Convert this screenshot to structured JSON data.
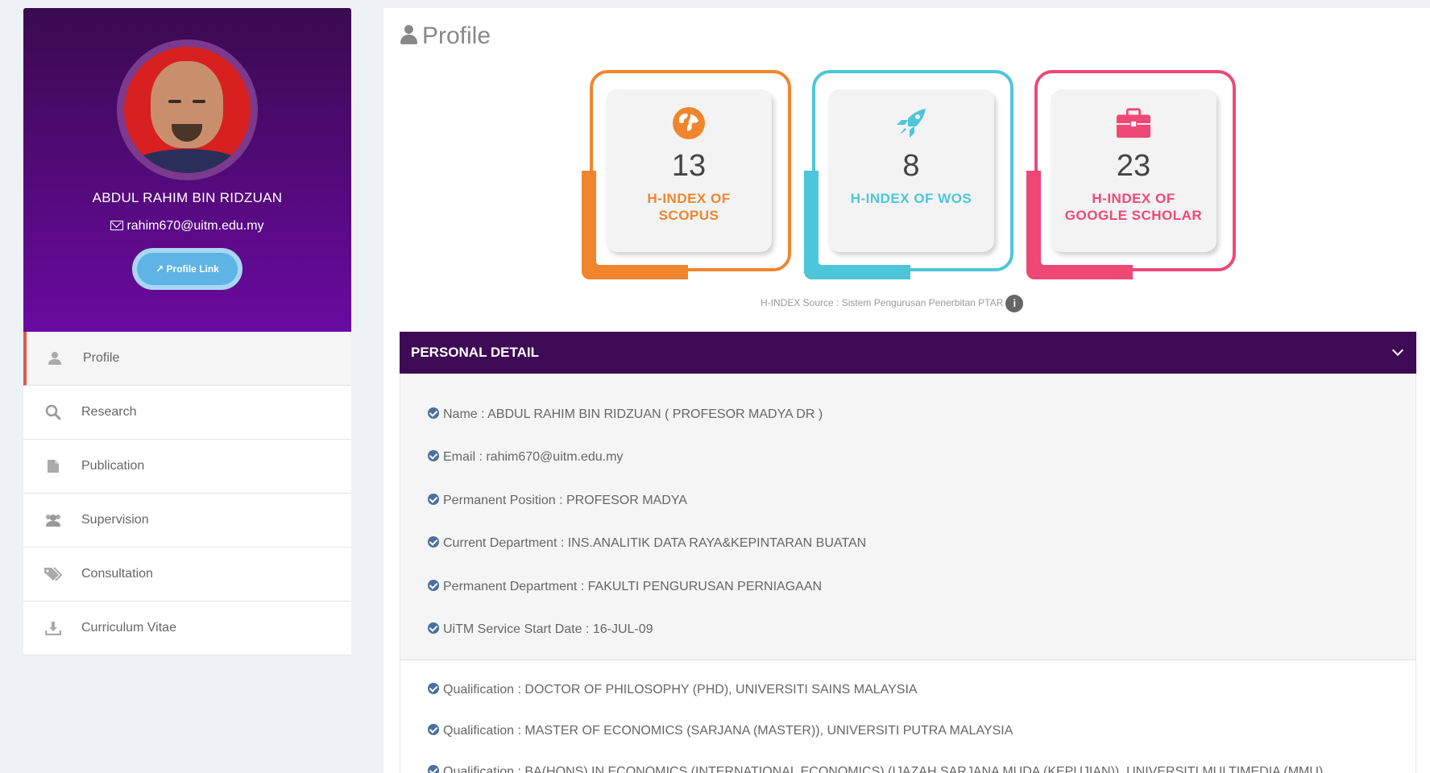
{
  "user": {
    "name": "ABDUL RAHIM BIN RIDZUAN",
    "email": "rahim670@uitm.edu.my",
    "profile_link_label": "Profile Link"
  },
  "nav": {
    "items": [
      {
        "label": "Profile",
        "icon": "user-icon",
        "active": true
      },
      {
        "label": "Research",
        "icon": "search-icon"
      },
      {
        "label": "Publication",
        "icon": "document-icon"
      },
      {
        "label": "Supervision",
        "icon": "users-icon"
      },
      {
        "label": "Consultation",
        "icon": "tags-icon"
      },
      {
        "label": "Curriculum Vitae",
        "icon": "download-icon"
      }
    ]
  },
  "page": {
    "title": "Profile"
  },
  "stats": [
    {
      "value": "13",
      "label_line1": "H-INDEX OF",
      "label_line2": "SCOPUS",
      "color": "#f0852d",
      "icon": "globe-icon"
    },
    {
      "value": "8",
      "label_line1": "H-INDEX OF WOS",
      "label_line2": "",
      "color": "#4cc6d8",
      "icon": "rocket-icon"
    },
    {
      "value": "23",
      "label_line1": "H-INDEX OF",
      "label_line2": "GOOGLE SCHOLAR",
      "color": "#ef4877",
      "icon": "briefcase-icon"
    }
  ],
  "source_note": "H-INDEX Source : Sistem Pengurusan Penerbitan PTAR",
  "personal_detail": {
    "heading": "PERSONAL DETAIL",
    "rows": [
      "Name : ABDUL RAHIM BIN RIDZUAN ( PROFESOR MADYA DR )",
      "Email : rahim670@uitm.edu.my",
      "Permanent Position : PROFESOR MADYA",
      "Current Department : INS.ANALITIK DATA RAYA&KEPINTARAN BUATAN",
      "Permanent Department : FAKULTI PENGURUSAN PERNIAGAAN",
      "UiTM Service Start Date : 16-JUL-09"
    ],
    "qualifications": [
      "Qualification : DOCTOR OF PHILOSOPHY (PHD), UNIVERSITI SAINS MALAYSIA",
      "Qualification : MASTER OF ECONOMICS (SARJANA (MASTER)), UNIVERSITI PUTRA MALAYSIA",
      "Qualification : BA(HONS) IN ECONOMICS (INTERNATIONAL ECONOMICS) (IJAZAH SARJANA MUDA (KEPUJIAN)), UNIVERSITI MULTIMEDIA (MMU)"
    ]
  }
}
